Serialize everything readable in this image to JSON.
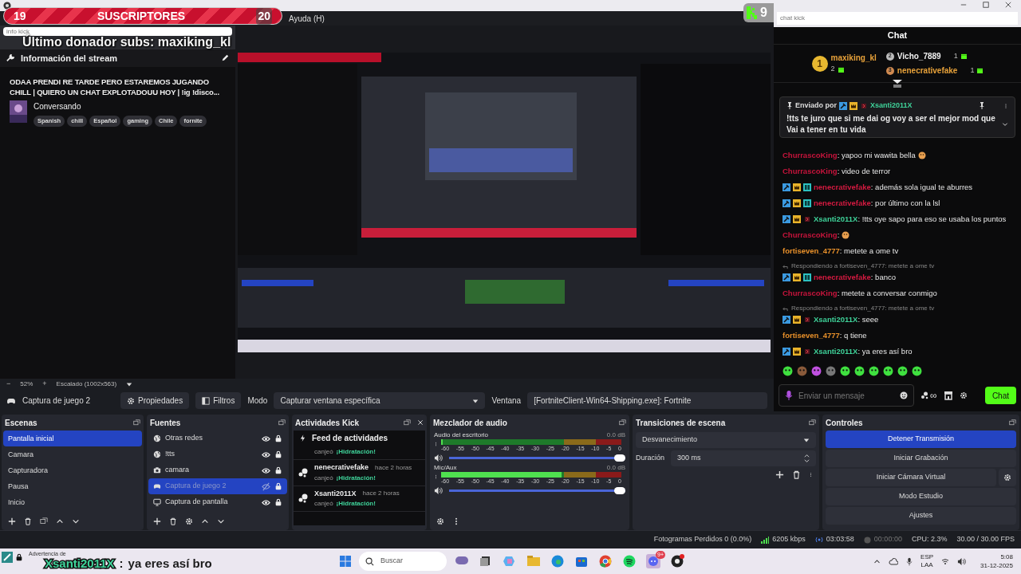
{
  "menu": {
    "item": "Ayuda (H)"
  },
  "subs_goal": {
    "current": "19",
    "label": "SUSCRIPTORES",
    "goal": "20"
  },
  "follower_badge": {
    "count": "9"
  },
  "donor_overlay": {
    "text": "Último donador subs: maxiking_kl"
  },
  "info_dock": {
    "address": "info kick",
    "header": "Información del stream",
    "stream_title": "ODAA PRENDI RE TARDE PERO ESTAREMOS JUGANDO CHILL | QUIERO UN CHAT EXPLOTADOUU HOY | !ig !disco...",
    "category": "Conversando",
    "tags": [
      "Spanish",
      "chill",
      "Español",
      "gaming",
      "Chile",
      "fornite"
    ]
  },
  "zoom_bar": {
    "minus": "−",
    "zoom": "52%",
    "plus": "+",
    "scaling": "Escalado (1002x563)"
  },
  "source_toolbar": {
    "source": "Captura de juego 2",
    "buttons": [
      "Propiedades",
      "Filtros"
    ],
    "mode_label": "Modo",
    "mode": "Capturar ventana específica",
    "window_label": "Ventana",
    "window": "[FortniteClient-Win64-Shipping.exe]: Fortnite"
  },
  "chat_window": {
    "address": "chat kick",
    "title": "Chat",
    "leaderboard": [
      {
        "rank": "1",
        "name": "maxiking_kl",
        "count": "2",
        "color": "#e8a23a"
      },
      {
        "rank": "2",
        "name": "Vicho_7889",
        "count": "1",
        "color": "#f0f0f0"
      },
      {
        "rank": "3",
        "name": "nenecrativefake",
        "count": "1",
        "color": "#e8a23a"
      }
    ],
    "pinned": {
      "label": "Enviado por",
      "badges": [
        {
          "kind": "mod"
        },
        {
          "kind": "crown"
        },
        {
          "kind": "sub"
        }
      ],
      "user": "Xsanti2011X",
      "color": "#3fd39a",
      "text": "!tts te juro que si me dai og voy a ser el mejor mod que Vai a tener en tu vida"
    },
    "messages": [
      {
        "kind": "message",
        "user": "ChurrascoKing",
        "color": "#c8143c",
        "text": ": yapoo mi wawita bella",
        "emote": true
      },
      {
        "kind": "message",
        "user": "ChurrascoKing",
        "color": "#c8143c",
        "text": ": video de terror",
        "emote": false
      },
      {
        "kind": "message",
        "badges": [
          {
            "kind": "mod"
          },
          {
            "kind": "crown"
          },
          {
            "kind": "og"
          }
        ],
        "user": "nenecrativefake",
        "color": "#d41a40",
        "text": ": además sola igual te aburres",
        "emote": false
      },
      {
        "kind": "message",
        "badges": [
          {
            "kind": "mod"
          },
          {
            "kind": "crown"
          },
          {
            "kind": "og"
          }
        ],
        "user": "nenecrativefake",
        "color": "#d41a40",
        "text": ": por último con la lsl",
        "emote": false
      },
      {
        "kind": "message",
        "badges": [
          {
            "kind": "mod"
          },
          {
            "kind": "crown"
          },
          {
            "kind": "sub"
          }
        ],
        "user": "Xsanti2011X",
        "color": "#3fd39a",
        "text": ": !tts oye sapo para eso se usaba los puntos",
        "emote": false
      },
      {
        "kind": "message",
        "user": "ChurrascoKing",
        "color": "#c8143c",
        "text": ":",
        "emote": true
      },
      {
        "kind": "message",
        "user": "fortiseven_4777",
        "color": "#e8902a",
        "text": ": metete a ome tv",
        "emote": false
      },
      {
        "kind": "reply",
        "text": "Respondiendo a fortiseven_4777: metete a ome tv"
      },
      {
        "kind": "message",
        "badges": [
          {
            "kind": "mod"
          },
          {
            "kind": "crown"
          },
          {
            "kind": "og"
          }
        ],
        "user": "nenecrativefake",
        "color": "#d41a40",
        "text": ": banco",
        "emote": false
      },
      {
        "kind": "message",
        "user": "ChurrascoKing",
        "color": "#c8143c",
        "text": ": metete a conversar conmigo",
        "emote": false
      },
      {
        "kind": "reply",
        "text": "Respondiendo a fortiseven_4777: metete a ome tv"
      },
      {
        "kind": "message",
        "badges": [
          {
            "kind": "mod"
          },
          {
            "kind": "crown"
          },
          {
            "kind": "sub"
          }
        ],
        "user": "Xsanti2011X",
        "color": "#3fd39a",
        "text": ": seee",
        "emote": false
      },
      {
        "kind": "message",
        "user": "fortiseven_4777",
        "color": "#e8902a",
        "text": ": q tiene",
        "emote": false
      },
      {
        "kind": "message",
        "badges": [
          {
            "kind": "mod"
          },
          {
            "kind": "crown"
          },
          {
            "kind": "sub"
          }
        ],
        "user": "Xsanti2011X",
        "color": "#3fd39a",
        "text": ": ya eres así bro",
        "emote": false
      }
    ],
    "input": {
      "placeholder": "Enviar un mensaje"
    },
    "points": "∞",
    "send_button": "Chat"
  },
  "scenes": {
    "title": "Escenas",
    "items": [
      {
        "label": "Pantalla inicial",
        "selected": true
      },
      {
        "label": "Camara",
        "selected": false
      },
      {
        "label": "Capturadora",
        "selected": false
      },
      {
        "label": "Pausa",
        "selected": false
      },
      {
        "label": "Inicio",
        "selected": false
      }
    ]
  },
  "sources": {
    "title": "Fuentes",
    "items": [
      {
        "label": "Otras redes",
        "kind": "browser",
        "visible": true,
        "selected": false
      },
      {
        "label": "!tts",
        "kind": "browser",
        "visible": true,
        "selected": false
      },
      {
        "label": "camara",
        "kind": "camera",
        "visible": true,
        "selected": false
      },
      {
        "label": "Captura de juego 2",
        "kind": "game",
        "visible": false,
        "selected": true
      },
      {
        "label": "Captura de pantalla",
        "kind": "display",
        "visible": true,
        "selected": false
      }
    ]
  },
  "activities": {
    "title": "Actividades Kick",
    "feed_title": "Feed de actividades",
    "items": [
      {
        "action": "canjeó",
        "reward": "¡Hidratación!"
      },
      {
        "user": "nenecrativefake",
        "time": "hace 2 horas",
        "action": "canjeó",
        "reward": "¡Hidratación!"
      },
      {
        "user": "Xsanti2011X",
        "time": "hace 2 horas",
        "action": "canjeó",
        "reward": "¡Hidratación!"
      }
    ]
  },
  "mixer": {
    "title": "Mezclador de audio",
    "channels": [
      {
        "name": "Audio del escritorio",
        "reading": "0.0 dB",
        "meter": {
          "level": 0
        },
        "volume": {
          "level": 1
        },
        "ticks": [
          "-60",
          "-55",
          "-50",
          "-45",
          "-40",
          "-35",
          "-30",
          "-25",
          "-20",
          "-15",
          "-10",
          "-5",
          "0"
        ]
      },
      {
        "name": "Mic/Aux",
        "reading": "0.0 dB",
        "meter": {
          "level": 0.67
        },
        "volume": {
          "level": 1
        },
        "ticks": [
          "-60",
          "-55",
          "-50",
          "-45",
          "-40",
          "-35",
          "-30",
          "-25",
          "-20",
          "-15",
          "-10",
          "-5",
          "0"
        ]
      }
    ]
  },
  "transitions": {
    "title": "Transiciones de escena",
    "transition": "Desvanecimiento",
    "duration_label": "Duración",
    "duration": "300 ms"
  },
  "controls": {
    "title": "Controles",
    "buttons": [
      {
        "label": "Detener Transmisión",
        "active": true
      },
      {
        "label": "Iniciar Grabación",
        "active": false
      },
      {
        "label": "Iniciar Cámara Virtual",
        "active": false
      },
      {
        "label": "Modo Estudio",
        "active": false
      },
      {
        "label": "Ajustes",
        "active": false
      }
    ]
  },
  "status_bar": {
    "dropped": "Fotogramas Perdidos 0 (0.0%)",
    "bitrate": "6205 kbps",
    "stream_time": "03:03:58",
    "record_time": "00:00:00",
    "cpu": "CPU: 2.3%",
    "fps": "30.00 / 30.00 FPS"
  },
  "taskbar": {
    "notification": "Advertencia de",
    "search": "Buscar",
    "discord_badge": "9+",
    "lang": "ESP",
    "region": "LAA",
    "time": "5:08",
    "date": "31-12-2025"
  },
  "chat_overlay": {
    "user": "Xsanti2011X",
    "separator": ":",
    "text": "ya eres así bro"
  }
}
